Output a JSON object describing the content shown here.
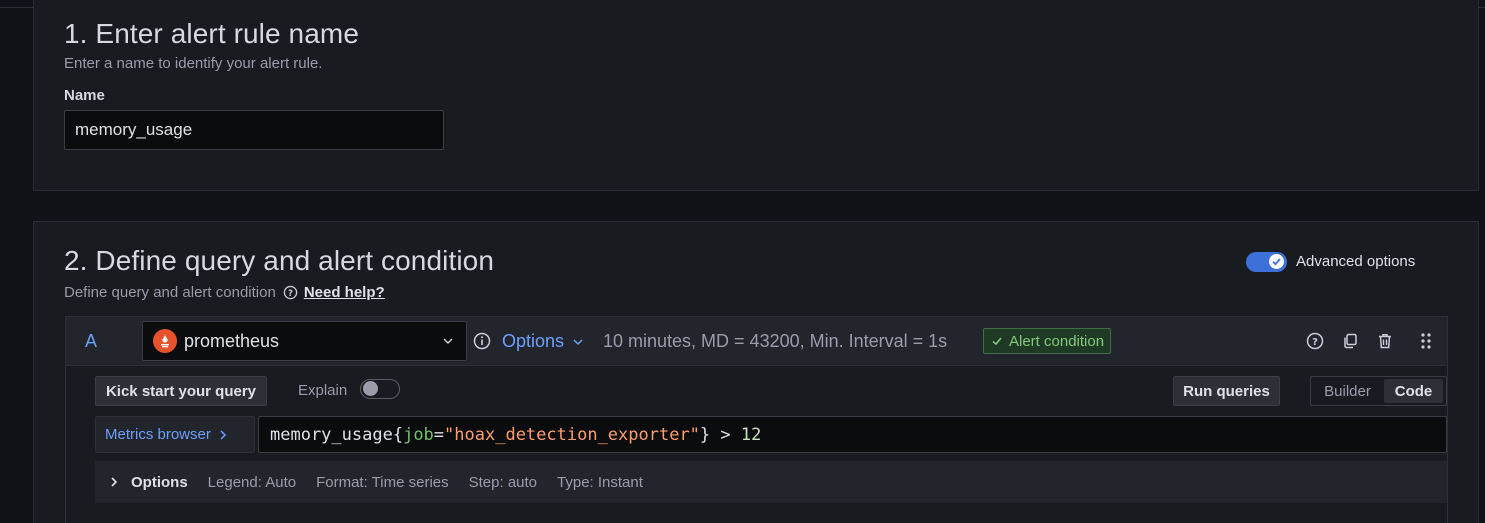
{
  "section1": {
    "title": "1. Enter alert rule name",
    "description": "Enter a name to identify your alert rule.",
    "name_label": "Name",
    "name_value": "memory_usage"
  },
  "section2": {
    "title": "2. Define query and alert condition",
    "description": "Define query and alert condition",
    "help_link": "Need help?",
    "advanced_toggle": {
      "label": "Advanced options",
      "checked": true
    }
  },
  "query": {
    "ref_id": "A",
    "datasource": {
      "name": "prometheus",
      "icon": "prometheus-icon",
      "color": "#e6522c"
    },
    "options_label": "Options",
    "options_summary": "10 minutes, MD = 43200, Min. Interval = 1s",
    "alert_condition_label": "Alert condition",
    "kick_start_label": "Kick start your query",
    "explain_label": "Explain",
    "explain_checked": false,
    "run_queries_label": "Run queries",
    "mode_options": [
      "Builder",
      "Code"
    ],
    "mode_selected": "Code",
    "metrics_browser_label": "Metrics browser",
    "expression": {
      "metric": "memory_usage",
      "open_brace": "{",
      "label_key": "job",
      "eq": "=",
      "label_value": "\"hoax_detection_exporter\"",
      "close_brace": "}",
      "operator": " > ",
      "threshold": "12"
    },
    "options_row": {
      "title": "Options",
      "legend": "Legend: Auto",
      "format": "Format: Time series",
      "step": "Step: auto",
      "type": "Type: Instant"
    }
  },
  "colors": {
    "accent": "#3d71d9",
    "link": "#6e9fff",
    "success": "#85c77b",
    "background": "#111217",
    "panel": "#181b1f"
  }
}
